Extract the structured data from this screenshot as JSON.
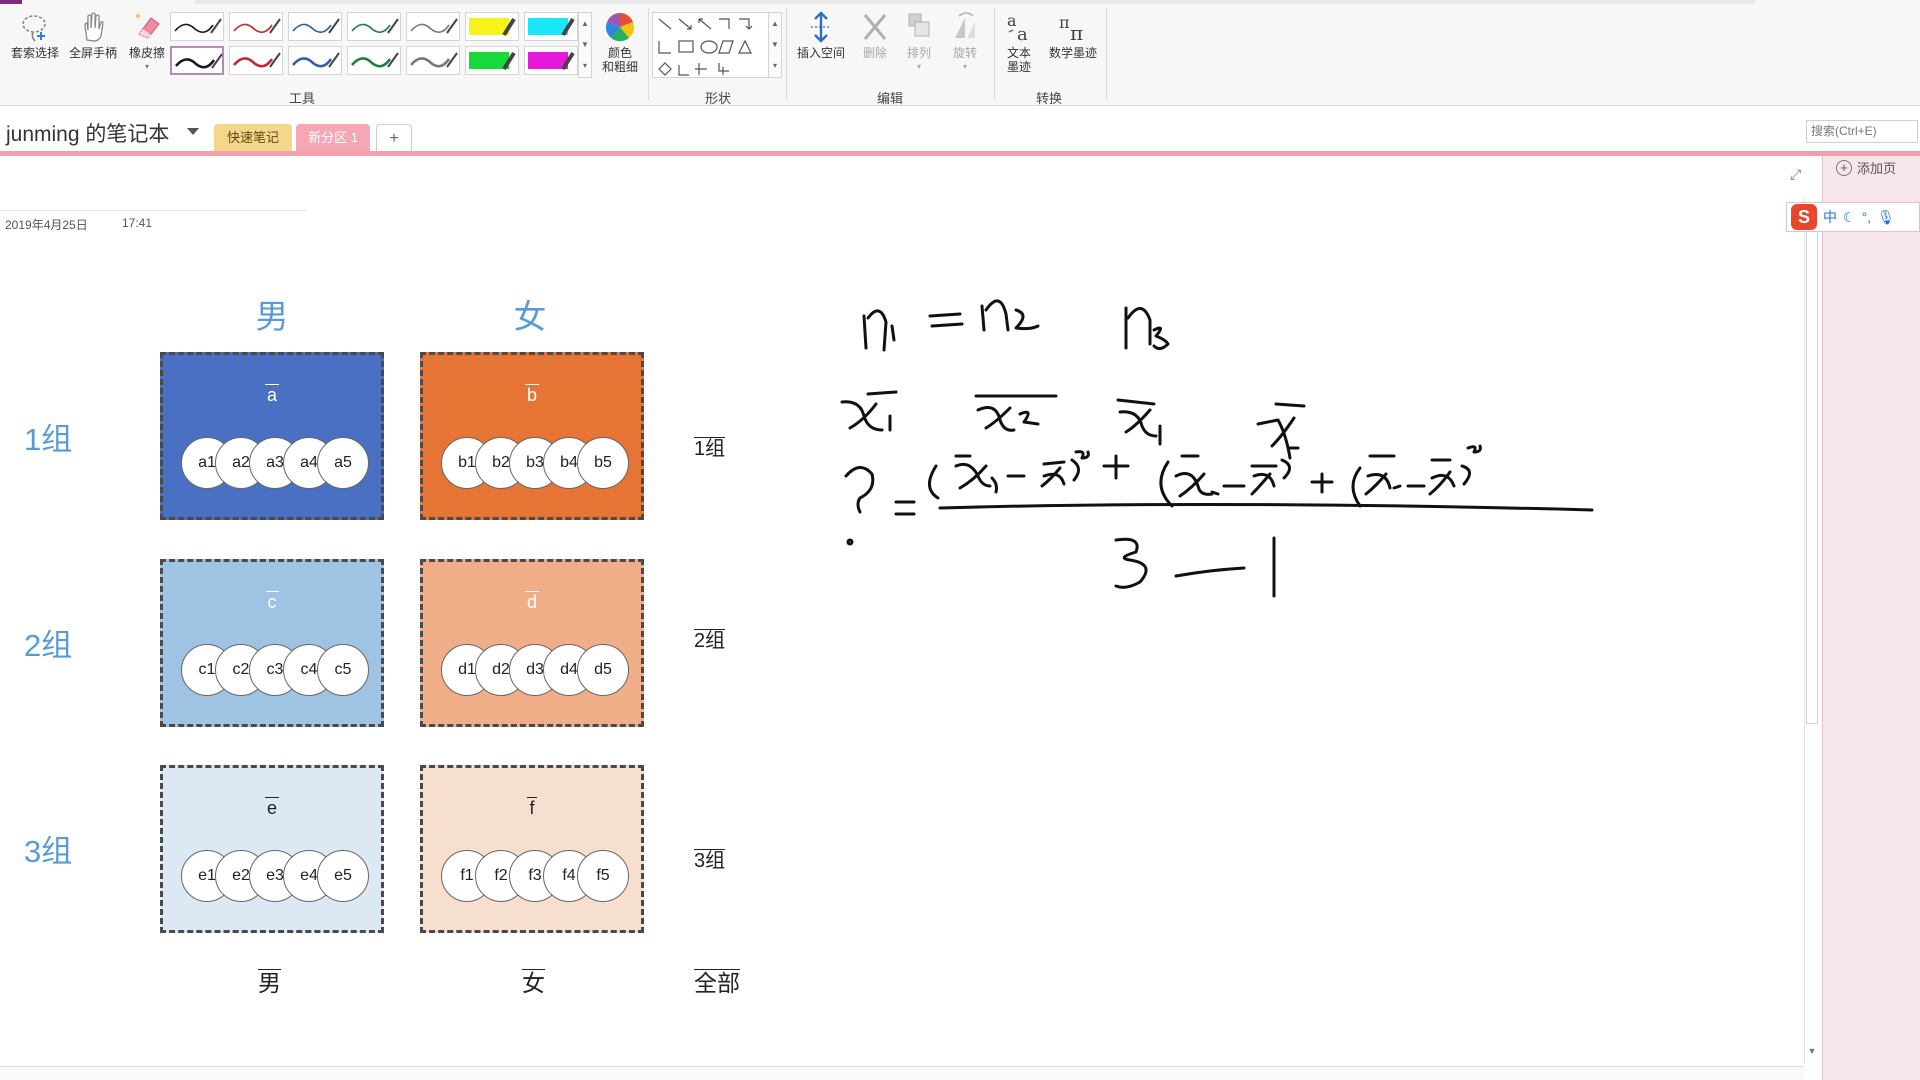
{
  "ribbon": {
    "tools": {
      "lasso_select": "套索选择",
      "panning_hand": "全屏手柄",
      "eraser": "橡皮擦",
      "color_thickness": "颜色\n和粗细",
      "insert_space": "插入空间",
      "delete": "删除",
      "arrange": "排列",
      "rotate": "旋转",
      "ink_to_text": "文本\n墨迹",
      "ink_to_math": "数学墨迹"
    },
    "groups": {
      "tools": "工具",
      "shapes": "形状",
      "edit": "编辑",
      "convert": "转换"
    },
    "pens": [
      {
        "color": "#1a1a1a",
        "kind": "pen"
      },
      {
        "color": "#c0282d",
        "kind": "pen"
      },
      {
        "color": "#2e5fa8",
        "kind": "pen"
      },
      {
        "color": "#1a7f3a",
        "kind": "pen"
      },
      {
        "color": "#777777",
        "kind": "pen"
      },
      {
        "color": "#f7f21a",
        "kind": "highlighter"
      },
      {
        "color": "#19e6f7",
        "kind": "highlighter"
      },
      {
        "color": "#1a1a1a",
        "kind": "pen"
      },
      {
        "color": "#c0282d",
        "kind": "pen"
      },
      {
        "color": "#2e5fa8",
        "kind": "pen"
      },
      {
        "color": "#1a7f3a",
        "kind": "pen"
      },
      {
        "color": "#777777",
        "kind": "pen"
      },
      {
        "color": "#18d93a",
        "kind": "highlighter"
      },
      {
        "color": "#e619d9",
        "kind": "highlighter"
      }
    ]
  },
  "notebook": {
    "title": "junming 的笔记本",
    "sections": {
      "quick_notes": "快速笔记",
      "new_section": "新分区 1",
      "add": "+"
    },
    "search_placeholder": "搜索(Ctrl+E)",
    "add_page": "添加页",
    "ime": "中"
  },
  "page": {
    "date": "2019年4月25日",
    "time": "17:41",
    "col_male": "男",
    "col_female": "女",
    "rows": [
      "1组",
      "2组",
      "3组"
    ],
    "boxes": [
      {
        "mean": "a",
        "items": [
          "a1",
          "a2",
          "a3",
          "a4",
          "a5"
        ],
        "fill": "#4a70c4",
        "text": "#ffffff"
      },
      {
        "mean": "b",
        "items": [
          "b1",
          "b2",
          "b3",
          "b4",
          "b5"
        ],
        "fill": "#e57435",
        "text": "#ffffff"
      },
      {
        "mean": "c",
        "items": [
          "c1",
          "c2",
          "c3",
          "c4",
          "c5"
        ],
        "fill": "#9ec3e3",
        "text": "#ffffff"
      },
      {
        "mean": "d",
        "items": [
          "d1",
          "d2",
          "d3",
          "d4",
          "d5"
        ],
        "fill": "#efae88",
        "text": "#ffffff"
      },
      {
        "mean": "e",
        "items": [
          "e1",
          "e2",
          "e3",
          "e4",
          "e5"
        ],
        "fill": "#dce8f3",
        "text": "#222222"
      },
      {
        "mean": "f",
        "items": [
          "f1",
          "f2",
          "f3",
          "f4",
          "f5"
        ],
        "fill": "#f7dfcf",
        "text": "#222222"
      }
    ],
    "group_means": [
      "1组",
      "2组",
      "3组"
    ],
    "bottom": {
      "male": "男",
      "female": "女",
      "all": "全部"
    }
  },
  "colors": {
    "accent_blue": "#5b9bd5",
    "section_pink": "#f0a1ad",
    "page_pane": "#f6e6ea"
  }
}
